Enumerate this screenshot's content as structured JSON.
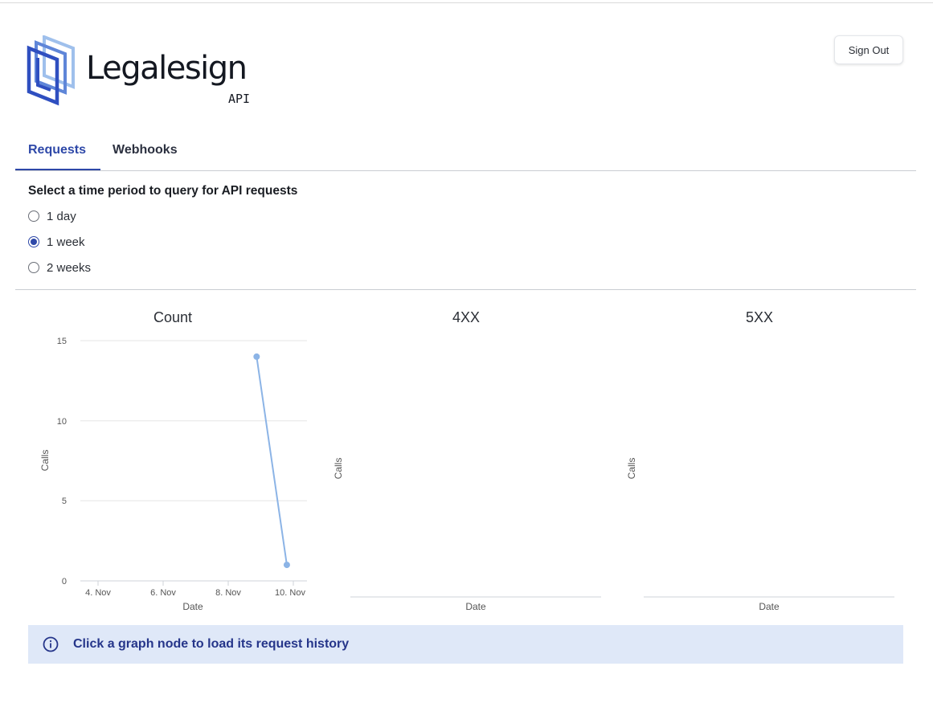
{
  "app": {
    "brand": "Legalesign",
    "brand_sub": "API",
    "logo_icon": "legalesign-logo-icon",
    "accent_color": "#2e48a8"
  },
  "header": {
    "sign_out_label": "Sign Out"
  },
  "tabs": [
    {
      "label": "Requests",
      "active": true
    },
    {
      "label": "Webhooks",
      "active": false
    }
  ],
  "period": {
    "title": "Select a time period to query for API requests",
    "options": [
      {
        "label": "1 day",
        "selected": false
      },
      {
        "label": "1 week",
        "selected": true
      },
      {
        "label": "2 weeks",
        "selected": false
      }
    ]
  },
  "chart_data": [
    {
      "type": "line",
      "title": "Count",
      "xlabel": "Date",
      "ylabel": "Calls",
      "x_ticks": [
        "4. Nov",
        "6. Nov",
        "8. Nov",
        "10. Nov"
      ],
      "y_ticks": [
        "0",
        "5",
        "10",
        "15"
      ],
      "ylim": [
        0,
        15
      ],
      "xlim": [
        "2023-11-03",
        "2023-11-10 12:00"
      ],
      "grid": true,
      "series": [
        {
          "color": "#8cb4e6",
          "points": [
            {
              "x": "2023-11-08 20:00",
              "y": 14
            },
            {
              "x": "2023-11-09 20:00",
              "y": 1
            }
          ]
        }
      ]
    },
    {
      "type": "line",
      "title": "4XX",
      "xlabel": "Date",
      "ylabel": "Calls",
      "series": []
    },
    {
      "type": "line",
      "title": "5XX",
      "xlabel": "Date",
      "ylabel": "Calls",
      "series": []
    }
  ],
  "banner": {
    "text": "Click a graph node to load its request history",
    "icon": "info-icon"
  }
}
